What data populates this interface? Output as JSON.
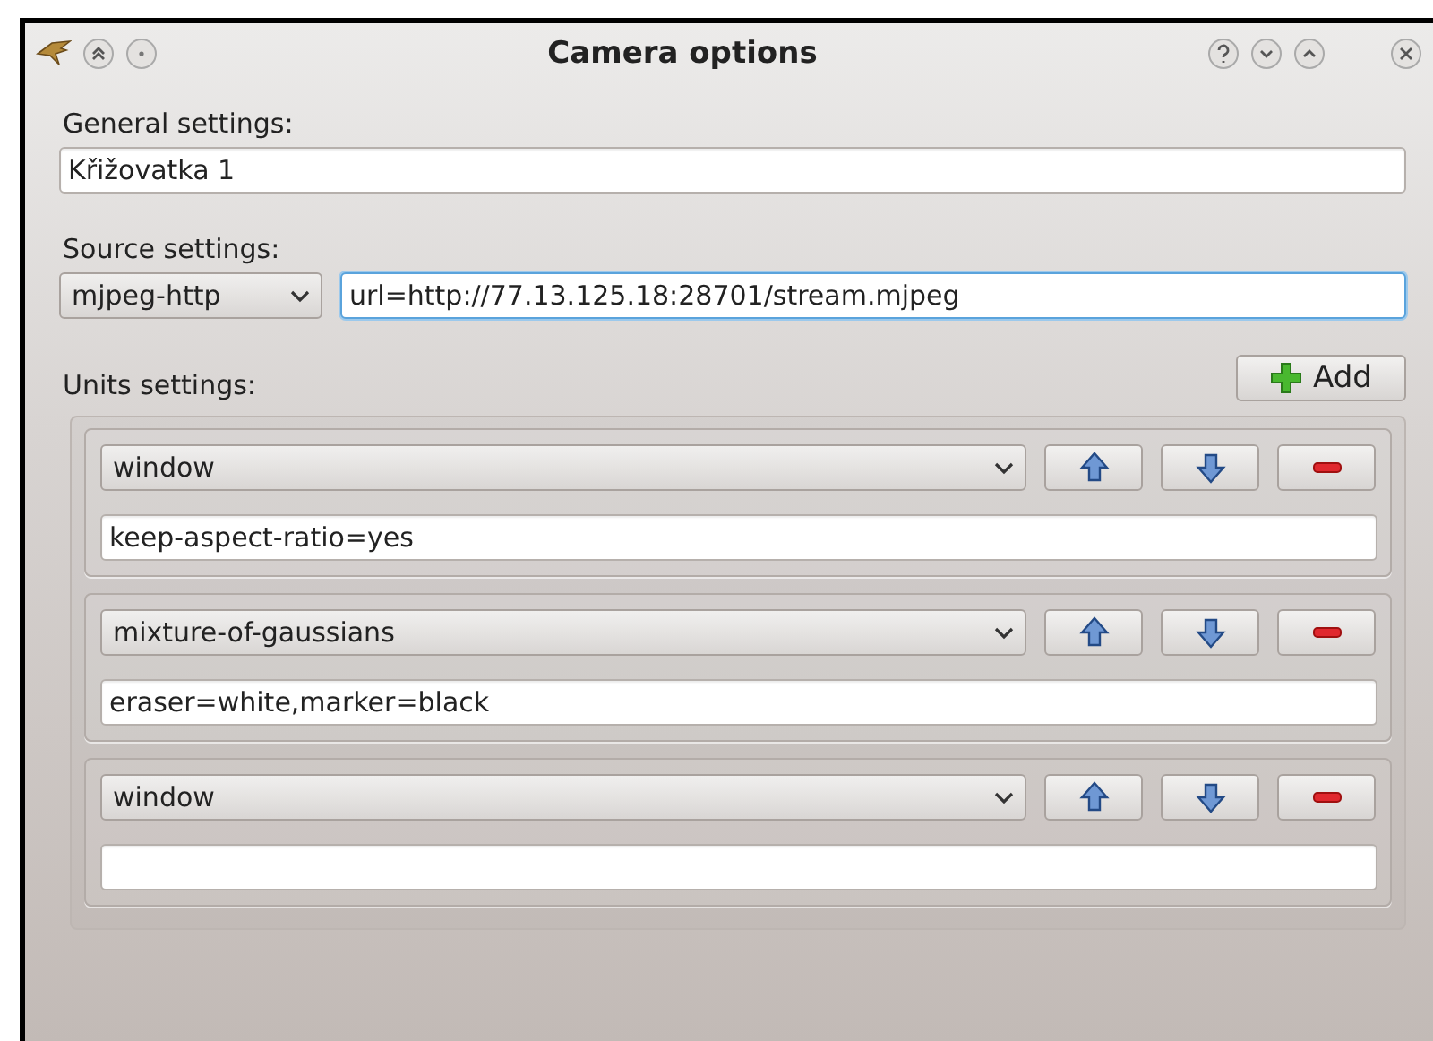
{
  "window": {
    "title": "Camera options"
  },
  "general": {
    "label": "General settings:",
    "name": "Křižovatka 1"
  },
  "source": {
    "label": "Source settings:",
    "type": "mjpeg-http",
    "params": "url=http://77.13.125.18:28701/stream.mjpeg",
    "focused": true
  },
  "units": {
    "label": "Units settings:",
    "add_button": "Add",
    "items": [
      {
        "type": "window",
        "params": "keep-aspect-ratio=yes"
      },
      {
        "type": "mixture-of-gaussians",
        "params": "eraser=white,marker=black"
      },
      {
        "type": "window"
      }
    ]
  }
}
